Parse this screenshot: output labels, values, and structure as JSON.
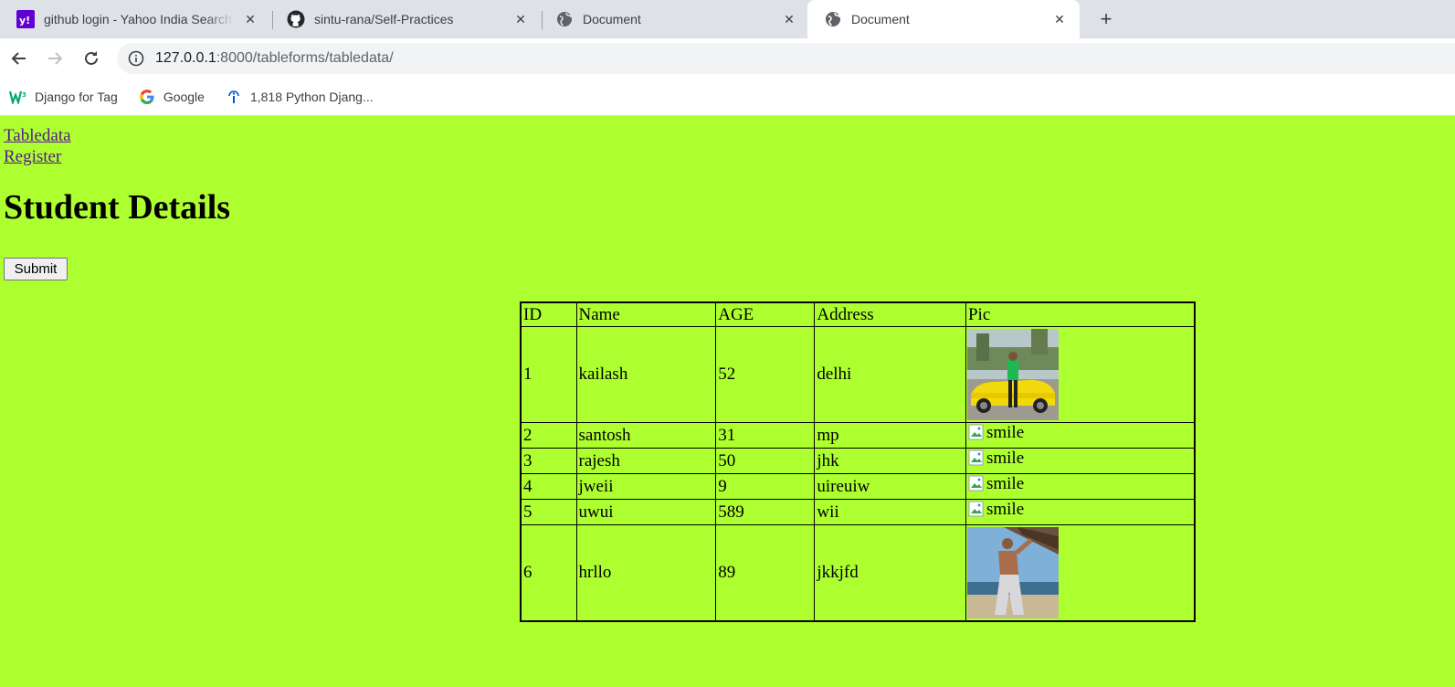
{
  "browser": {
    "tabs": [
      {
        "title": "github login - Yahoo India Search",
        "favicon": "yahoo-icon"
      },
      {
        "title": "sintu-rana/Self-Practices",
        "favicon": "github-icon"
      },
      {
        "title": "Document",
        "favicon": "globe-icon"
      },
      {
        "title": "Document",
        "favicon": "globe-icon",
        "active": true
      }
    ],
    "new_tab_label": "+",
    "url_host": "127.0.0.1",
    "url_rest": ":8000/tableforms/tabledata/",
    "bookmarks": [
      {
        "label": "Django for Tag",
        "icon": "w3-icon"
      },
      {
        "label": "Google",
        "icon": "google-icon"
      },
      {
        "label": "1,818 Python Djang...",
        "icon": "info-icon"
      }
    ]
  },
  "page": {
    "background": "#adff2f",
    "links": {
      "tabledata": "Tabledata",
      "register": "Register"
    },
    "heading": "Student Details",
    "submit_label": "Submit",
    "table": {
      "headers": [
        "ID",
        "Name",
        "AGE",
        "Address",
        "Pic"
      ],
      "rows": [
        {
          "id": "1",
          "name": "kailash",
          "age": "52",
          "address": "delhi",
          "pic": "photo-man-with-yellow-car"
        },
        {
          "id": "2",
          "name": "santosh",
          "age": "31",
          "address": "mp",
          "pic_alt": "smile"
        },
        {
          "id": "3",
          "name": "rajesh",
          "age": "50",
          "address": "jhk",
          "pic_alt": "smile"
        },
        {
          "id": "4",
          "name": "jweii",
          "age": "9",
          "address": "uireuiw",
          "pic_alt": "smile"
        },
        {
          "id": "5",
          "name": "uwui",
          "age": "589",
          "address": "wii",
          "pic_alt": "smile"
        },
        {
          "id": "6",
          "name": "hrllo",
          "age": "89",
          "address": "jkkjfd",
          "pic": "photo-man-on-beach"
        }
      ]
    }
  }
}
